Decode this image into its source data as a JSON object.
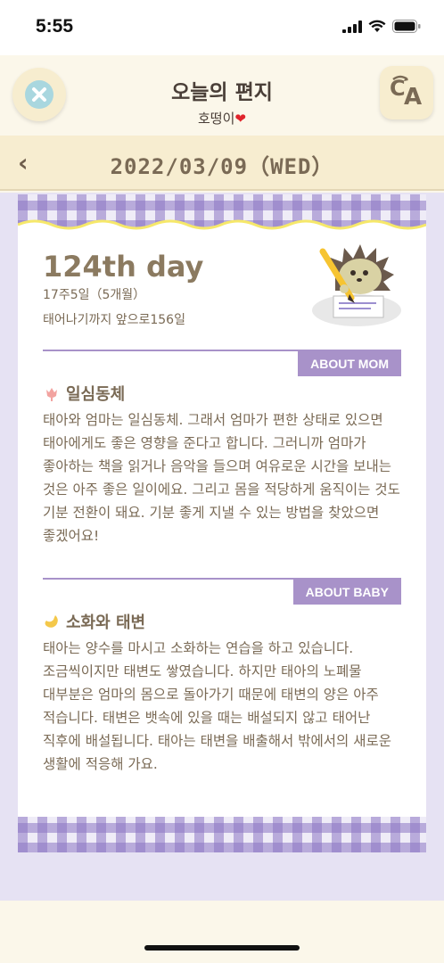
{
  "status": {
    "time": "5:55"
  },
  "header": {
    "title": "오늘의 편지",
    "subtitle": "호떵이",
    "subtitle_heart": "❤"
  },
  "date_bar": {
    "back_icon": "chevron-left-icon",
    "date": "2022/03/09（WED）"
  },
  "card": {
    "day_title": "124th day",
    "week_info": "17주5일（5개월）",
    "remaining": "태어나기까지 앞으로156일",
    "sections": [
      {
        "badge": "ABOUT MOM",
        "title": "일심동체",
        "icon": "tulip-icon",
        "body": "태아와 엄마는 일심동체. 그래서 엄마가 편한 상태로 있으면 태아에게도 좋은 영향을 준다고 합니다. 그러니까 엄마가 좋아하는 책을 읽거나 음악을 들으며 여유로운 시간을 보내는 것은 아주 좋은 일이에요. 그리고 몸을 적당하게 움직이는 것도 기분 전환이 돼요. 기분 좋게 지낼 수 있는 방법을 찾았으면 좋겠어요!"
      },
      {
        "badge": "ABOUT BABY",
        "title": "소화와 태변",
        "icon": "baby-icon",
        "body": "태아는 양수를 마시고 소화하는 연습을 하고 있습니다. 조금씩이지만 태변도 쌓였습니다. 하지만 태아의 노폐물 대부분은 엄마의 몸으로 돌아가기 때문에 태변의 양은 아주 적습니다. 태변은 뱃속에 있을 때는 배설되지 않고 태어난 직후에 배설됩니다. 태아는 태변을 배출해서 밖에서의 새로운 생활에 적응해 가요."
      }
    ]
  },
  "colors": {
    "accent_purple": "#a892c9",
    "cream": "#f7edd0",
    "lavender": "#e6e2f3",
    "text_brown": "#7a6a55"
  }
}
